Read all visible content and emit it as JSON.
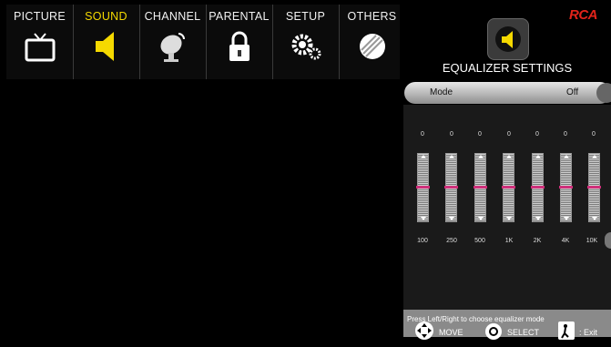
{
  "menu": {
    "tabs": [
      {
        "label": "PICTURE",
        "icon": "tv-icon",
        "active": false
      },
      {
        "label": "SOUND",
        "icon": "speaker-icon",
        "active": true
      },
      {
        "label": "CHANNEL",
        "icon": "satellite-dish-icon",
        "active": false
      },
      {
        "label": "PARENTAL",
        "icon": "lock-icon",
        "active": false
      },
      {
        "label": "SETUP",
        "icon": "gears-icon",
        "active": false
      },
      {
        "label": "OTHERS",
        "icon": "disc-icon",
        "active": false
      }
    ]
  },
  "brand": {
    "logo_text": "RCA",
    "color": "#e2231a"
  },
  "panel": {
    "title": "EQUALIZER SETTINGS",
    "icon": "speaker-icon",
    "mode": {
      "label": "Mode",
      "value": "Off"
    },
    "bands": [
      {
        "freq": "100",
        "value": "0"
      },
      {
        "freq": "250",
        "value": "0"
      },
      {
        "freq": "500",
        "value": "0"
      },
      {
        "freq": "1K",
        "value": "0"
      },
      {
        "freq": "2K",
        "value": "0"
      },
      {
        "freq": "4K",
        "value": "0"
      },
      {
        "freq": "10K",
        "value": "0"
      }
    ],
    "hint": "Press Left/Right to choose equalizer mode"
  },
  "footer": {
    "move": "MOVE",
    "select": "SELECT",
    "exit": ": Exit"
  },
  "colors": {
    "accent": "#f5d900",
    "slider_thumb": "#cf2f7a"
  }
}
